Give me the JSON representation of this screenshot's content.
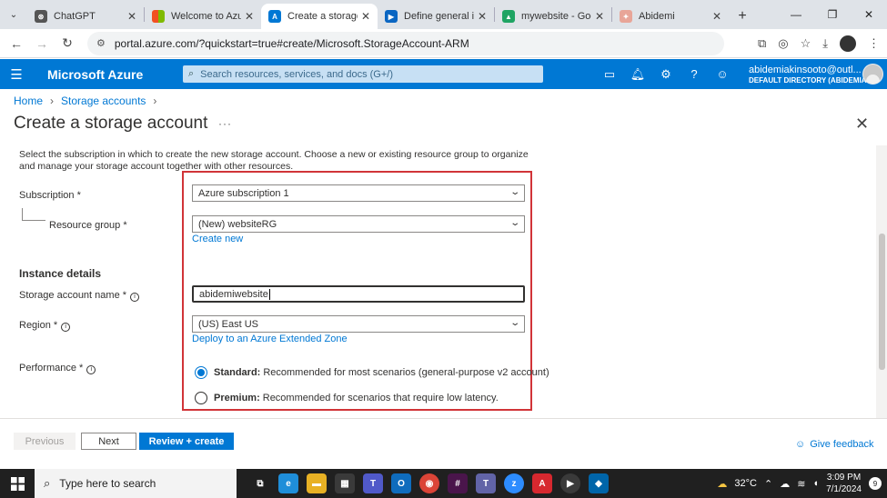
{
  "browser": {
    "tabs": [
      {
        "title": "ChatGPT",
        "icon": "chatgpt-icon",
        "color": "#555555",
        "active": false
      },
      {
        "title": "Welcome to Azure",
        "icon": "microsoft-icon",
        "color": "#f25022",
        "active": false
      },
      {
        "title": "Create a storage a",
        "icon": "azure-icon",
        "color": "#0078d4",
        "active": true
      },
      {
        "title": "Define general inf",
        "icon": "video-icon",
        "color": "#0a66c2",
        "active": false
      },
      {
        "title": "mywebsite - Goog",
        "icon": "google-drive-icon",
        "color": "#1fa463",
        "active": false
      },
      {
        "title": "Abidemi",
        "icon": "profile-icon",
        "color": "#e8a598",
        "active": false
      }
    ],
    "url": "portal.azure.com/?quickstart=true#create/Microsoft.StorageAccount-ARM"
  },
  "azure_header": {
    "brand": "Microsoft Azure",
    "search_placeholder": "Search resources, services, and docs (G+/)",
    "account_email": "abidemiakinsooto@outl...",
    "account_directory": "DEFAULT DIRECTORY (ABIDEMIA..."
  },
  "breadcrumb": [
    "Home",
    "Storage accounts"
  ],
  "page_title": "Create a storage account",
  "intro_text": "Select the subscription in which to create the new storage account. Choose a new or existing resource group to organize and manage your storage account together with other resources.",
  "form": {
    "subscription_label": "Subscription *",
    "subscription_value": "Azure subscription 1",
    "resource_group_label": "Resource group *",
    "resource_group_value": "(New) websiteRG",
    "create_new_link": "Create new",
    "instance_details_heading": "Instance details",
    "storage_name_label": "Storage account name *",
    "storage_name_value": "abidemiwebsite",
    "region_label": "Region *",
    "region_value": "(US) East US",
    "extended_zone_link": "Deploy to an Azure Extended Zone",
    "performance_label": "Performance *",
    "performance_options": [
      {
        "name": "Standard:",
        "desc": "Recommended for most scenarios (general-purpose v2 account)",
        "selected": true
      },
      {
        "name": "Premium:",
        "desc": "Recommended for scenarios that require low latency.",
        "selected": false
      }
    ]
  },
  "footer": {
    "previous": "Previous",
    "next": "Next",
    "review": "Review + create",
    "feedback": "Give feedback"
  },
  "taskbar": {
    "search_placeholder": "Type here to search",
    "temperature": "32°C",
    "time": "3:09 PM",
    "date": "7/1/2024",
    "notifications": "9"
  },
  "colors": {
    "azure_blue": "#0078d4",
    "highlight_red": "#d13438"
  }
}
